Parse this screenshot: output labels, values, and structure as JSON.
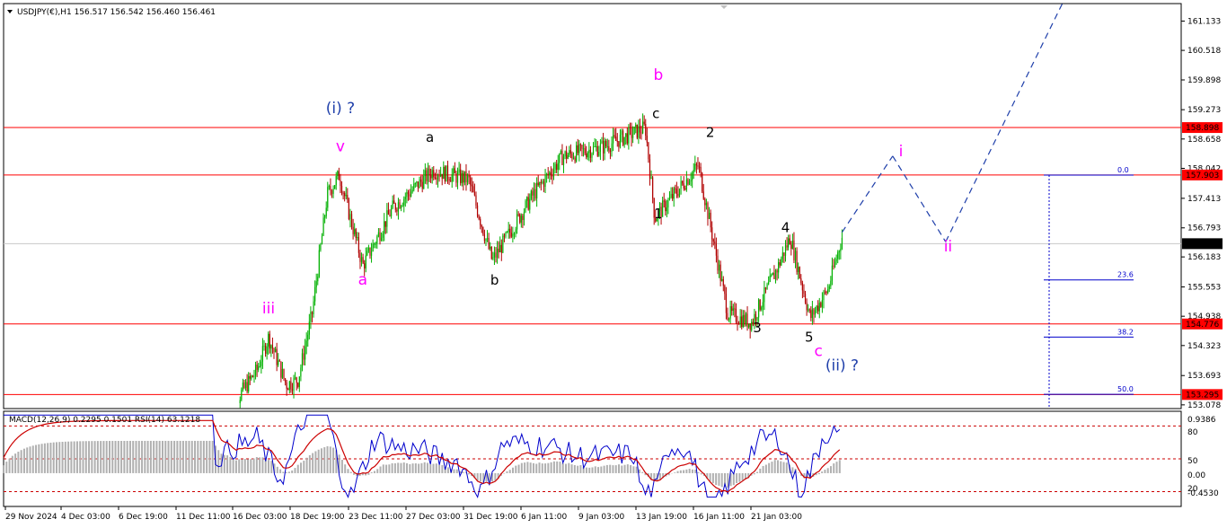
{
  "header": {
    "symbol_text": "USDJPY(€),H1  156.517 156.542 156.460 156.461"
  },
  "chart_data": [
    {
      "type": "candlestick",
      "title": "USDJPY(€),H1",
      "ohlc_last": {
        "open": 156.517,
        "high": 156.542,
        "low": 156.46,
        "close": 156.461
      },
      "ylim": [
        153.0,
        161.5
      ],
      "y_ticks": [
        "161.133",
        "160.518",
        "159.898",
        "159.273",
        "158.658",
        "158.042",
        "157.413",
        "156.793",
        "156.183",
        "155.553",
        "154.938",
        "154.323",
        "153.693",
        "153.078"
      ],
      "x_ticks": [
        "29 Nov 2024",
        "4 Dec 03:00",
        "6 Dec 19:00",
        "11 Dec 11:00",
        "16 Dec 03:00",
        "18 Dec 19:00",
        "23 Dec 11:00",
        "27 Dec 03:00",
        "31 Dec 19:00",
        "6 Jan 11:00",
        "9 Jan 03:00",
        "13 Jan 19:00",
        "16 Jan 11:00",
        "21 Jan 03:00"
      ],
      "path_points": [
        {
          "t": 0.19,
          "p": 152.9
        },
        {
          "t": 0.215,
          "p": 153.8
        },
        {
          "t": 0.225,
          "p": 154.5
        },
        {
          "t": 0.24,
          "p": 153.5
        },
        {
          "t": 0.25,
          "p": 153.6
        },
        {
          "t": 0.262,
          "p": 155.0
        },
        {
          "t": 0.275,
          "p": 157.5
        },
        {
          "t": 0.285,
          "p": 157.9
        },
        {
          "t": 0.305,
          "p": 156.0
        },
        {
          "t": 0.33,
          "p": 157.2
        },
        {
          "t": 0.365,
          "p": 158.0
        },
        {
          "t": 0.395,
          "p": 157.8
        },
        {
          "t": 0.415,
          "p": 156.1
        },
        {
          "t": 0.45,
          "p": 157.5
        },
        {
          "t": 0.475,
          "p": 158.3
        },
        {
          "t": 0.51,
          "p": 158.5
        },
        {
          "t": 0.545,
          "p": 158.9
        },
        {
          "t": 0.553,
          "p": 157.0
        },
        {
          "t": 0.59,
          "p": 158.1
        },
        {
          "t": 0.615,
          "p": 155.0
        },
        {
          "t": 0.635,
          "p": 154.8
        },
        {
          "t": 0.658,
          "p": 156.0
        },
        {
          "t": 0.668,
          "p": 156.6
        },
        {
          "t": 0.685,
          "p": 154.9
        },
        {
          "t": 0.7,
          "p": 155.5
        },
        {
          "t": 0.712,
          "p": 156.6
        }
      ],
      "horizontal_levels": [
        158.898,
        157.903,
        154.776,
        153.295
      ],
      "current_price_line": 156.461,
      "fibonacci": [
        {
          "label": "0.0",
          "price": 157.9
        },
        {
          "label": "23.6",
          "price": 155.7
        },
        {
          "label": "38.2",
          "price": 154.5
        },
        {
          "label": "50.0",
          "price": 153.3
        }
      ],
      "projection": {
        "color": "#1f3faa",
        "points": [
          {
            "t": 0.712,
            "p": 156.7
          },
          {
            "t": 0.755,
            "p": 158.3
          },
          {
            "t": 0.8,
            "p": 156.5
          },
          {
            "t": 0.905,
            "p": 161.8
          }
        ]
      },
      "wave_labels": [
        {
          "text": "(i) ?",
          "color": "#1f3faa",
          "t": 0.286,
          "p": 159.2,
          "size": "lg"
        },
        {
          "text": "v",
          "color": "#ff00ff",
          "t": 0.286,
          "p": 158.4,
          "size": "lg"
        },
        {
          "text": "iii",
          "color": "#ff00ff",
          "t": 0.225,
          "p": 155.0,
          "size": "lg"
        },
        {
          "text": "a",
          "color": "#ff00ff",
          "t": 0.305,
          "p": 155.6,
          "size": "lg"
        },
        {
          "text": "a",
          "color": "#000000",
          "t": 0.362,
          "p": 158.6,
          "size": "sm"
        },
        {
          "text": "b",
          "color": "#000000",
          "t": 0.417,
          "p": 155.6,
          "size": "sm"
        },
        {
          "text": "b",
          "color": "#ff00ff",
          "t": 0.556,
          "p": 159.9,
          "size": "lg"
        },
        {
          "text": "c",
          "color": "#000000",
          "t": 0.554,
          "p": 159.1,
          "size": "sm"
        },
        {
          "text": "1",
          "color": "#000000",
          "t": 0.556,
          "p": 157.0,
          "size": "sm"
        },
        {
          "text": "2",
          "color": "#000000",
          "t": 0.6,
          "p": 158.7,
          "size": "sm"
        },
        {
          "text": "3",
          "color": "#000000",
          "t": 0.64,
          "p": 154.6,
          "size": "sm"
        },
        {
          "text": "4",
          "color": "#000000",
          "t": 0.664,
          "p": 156.7,
          "size": "sm"
        },
        {
          "text": "5",
          "color": "#000000",
          "t": 0.684,
          "p": 154.4,
          "size": "sm"
        },
        {
          "text": "c",
          "color": "#ff00ff",
          "t": 0.692,
          "p": 154.1,
          "size": "lg"
        },
        {
          "text": "(ii) ?",
          "color": "#1f3faa",
          "t": 0.712,
          "p": 153.8,
          "size": "lg"
        },
        {
          "text": "i",
          "color": "#ff00ff",
          "t": 0.762,
          "p": 158.3,
          "size": "lg"
        },
        {
          "text": "ii",
          "color": "#ff00ff",
          "t": 0.802,
          "p": 156.3,
          "size": "lg"
        }
      ],
      "price_tags": [
        {
          "text": "158.898",
          "price": 158.898,
          "bg": "#ff0000",
          "fg": "#ffffff"
        },
        {
          "text": "157.903",
          "price": 157.903,
          "bg": "#ff0000",
          "fg": "#ffffff"
        },
        {
          "text": "156.461",
          "price": 156.461,
          "bg": "#000000",
          "fg": "#ffffff"
        },
        {
          "text": "154.776",
          "price": 154.776,
          "bg": "#ff0000",
          "fg": "#ffffff"
        },
        {
          "text": "153.295",
          "price": 153.295,
          "bg": "#ff0000",
          "fg": "#ffffff"
        }
      ],
      "colors": {
        "up": "#00b000",
        "down": "#b00000",
        "level": "#ff0000",
        "fib": "#0000cc"
      }
    },
    {
      "type": "line",
      "title": "MACD(12,26,9) 0.2295 0.1501  RSI(14) 63.1218",
      "macd_ticks": [
        "0.9386",
        "0.00",
        "-0.4530"
      ],
      "rsi_ticks": [
        "80",
        "50",
        "20"
      ],
      "rsi_levels": [
        80,
        50,
        20
      ],
      "colors": {
        "rsi": "#0000cc",
        "signal": "#cc0000",
        "histogram": "#b0b0b0"
      }
    }
  ]
}
